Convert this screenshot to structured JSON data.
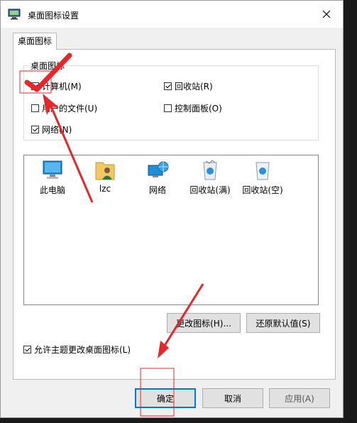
{
  "window": {
    "title": "桌面图标设置"
  },
  "tabs": [
    {
      "label": "桌面图标"
    }
  ],
  "desktop_icons_group": {
    "legend": "桌面图标",
    "checkboxes": [
      {
        "label": "计算机(M)",
        "checked": true
      },
      {
        "label": "用户的文件(U)",
        "checked": false
      },
      {
        "label": "网络(N)",
        "checked": true
      },
      {
        "label": "回收站(R)",
        "checked": true
      },
      {
        "label": "控制面板(O)",
        "checked": false
      }
    ]
  },
  "icon_list": [
    {
      "label": "此电脑",
      "icon": "computer-icon"
    },
    {
      "label": "lzc",
      "icon": "user-folder-icon"
    },
    {
      "label": "网络",
      "icon": "network-icon"
    },
    {
      "label": "回收站(满)",
      "icon": "recycle-bin-full-icon"
    },
    {
      "label": "回收站(空)",
      "icon": "recycle-bin-empty-icon"
    }
  ],
  "buttons": {
    "change_icon": "更改图标(H)...",
    "restore_default": "还原默认值(S)",
    "ok": "确定",
    "cancel": "取消",
    "apply": "应用(A)"
  },
  "allow_themes": {
    "label": "允许主题更改桌面图标(L)",
    "checked": true
  },
  "annotations": {
    "color": "#e8262a"
  }
}
